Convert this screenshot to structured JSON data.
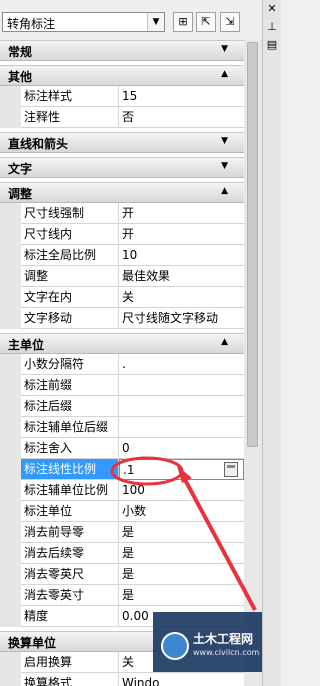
{
  "topbar": {
    "dropdown_value": "转角标注",
    "dropdown_icon": "chevron-down-icon",
    "buttons": [
      {
        "icon": "add-to-selection-icon"
      },
      {
        "icon": "quick-select-icon"
      },
      {
        "icon": "select-objects-icon"
      }
    ]
  },
  "side": {
    "icons": [
      "close-x-icon",
      "pin-icon",
      "properties-icon"
    ]
  },
  "sections": [
    {
      "title": "常规",
      "expanded": false,
      "rows": []
    },
    {
      "title": "其他",
      "expanded": true,
      "rows": [
        {
          "label": "标注样式",
          "value": "15"
        },
        {
          "label": "注释性",
          "value": "否"
        }
      ]
    },
    {
      "title": "直线和箭头",
      "expanded": false,
      "rows": []
    },
    {
      "title": "文字",
      "expanded": false,
      "rows": []
    },
    {
      "title": "调整",
      "expanded": true,
      "rows": [
        {
          "label": "尺寸线强制",
          "value": "开"
        },
        {
          "label": "尺寸线内",
          "value": "开"
        },
        {
          "label": "标注全局比例",
          "value": "10"
        },
        {
          "label": "调整",
          "value": "最佳效果"
        },
        {
          "label": "文字在内",
          "value": "关"
        },
        {
          "label": "文字移动",
          "value": "尺寸线随文字移动"
        }
      ]
    },
    {
      "title": "主单位",
      "expanded": true,
      "rows": [
        {
          "label": "小数分隔符",
          "value": "."
        },
        {
          "label": "标注前缀",
          "value": ""
        },
        {
          "label": "标注后缀",
          "value": ""
        },
        {
          "label": "标注辅单位后缀",
          "value": ""
        },
        {
          "label": "标注舍入",
          "value": "0"
        },
        {
          "label": "标注线性比例",
          "value": ".1",
          "selected": true
        },
        {
          "label": "标注辅单位比例",
          "value": "100"
        },
        {
          "label": "标注单位",
          "value": "小数"
        },
        {
          "label": "消去前导零",
          "value": "是"
        },
        {
          "label": "消去后续零",
          "value": "是"
        },
        {
          "label": "消去零英尺",
          "value": "是"
        },
        {
          "label": "消去零英寸",
          "value": "是"
        },
        {
          "label": "精度",
          "value": "0.00"
        }
      ]
    },
    {
      "title": "换算单位",
      "expanded": true,
      "rows": [
        {
          "label": "启用换算",
          "value": "关"
        },
        {
          "label": "换算格式",
          "value": "Windo"
        }
      ]
    }
  ],
  "annotation": {
    "color": "#e8323c"
  },
  "watermark": {
    "name": "土木工程网",
    "url": "www.civilcn.com"
  }
}
